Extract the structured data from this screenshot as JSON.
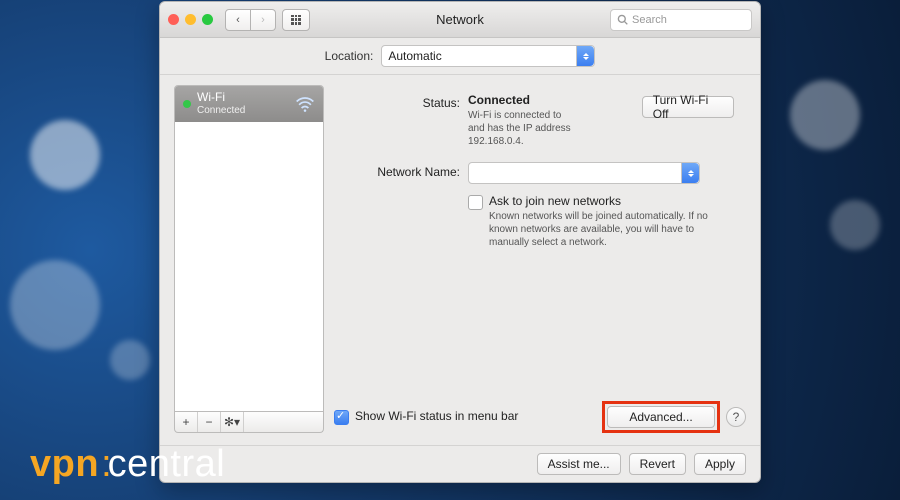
{
  "window": {
    "title": "Network",
    "search_placeholder": "Search"
  },
  "nav": {
    "back": "‹",
    "forward": "›"
  },
  "location": {
    "label": "Location:",
    "value": "Automatic"
  },
  "sidebar": {
    "service": {
      "name": "Wi-Fi",
      "status": "Connected"
    },
    "tools": {
      "add": "+",
      "remove": "−",
      "action": "✻▾"
    }
  },
  "status": {
    "label": "Status:",
    "value": "Connected",
    "detail_1": "Wi-Fi is connected to",
    "detail_2": "and has the IP address 192.168.0.4.",
    "turn_off": "Turn Wi-Fi Off"
  },
  "network_name": {
    "label": "Network Name:",
    "value": ""
  },
  "ask_join": {
    "label": "Ask to join new networks",
    "detail": "Known networks will be joined automatically. If no known networks are available, you will have to manually select a network."
  },
  "menubar": {
    "label": "Show Wi-Fi status in menu bar"
  },
  "buttons": {
    "advanced": "Advanced...",
    "help": "?",
    "assist": "Assist me...",
    "revert": "Revert",
    "apply": "Apply"
  },
  "watermark": {
    "vpn": "vpn",
    "central": "central"
  }
}
